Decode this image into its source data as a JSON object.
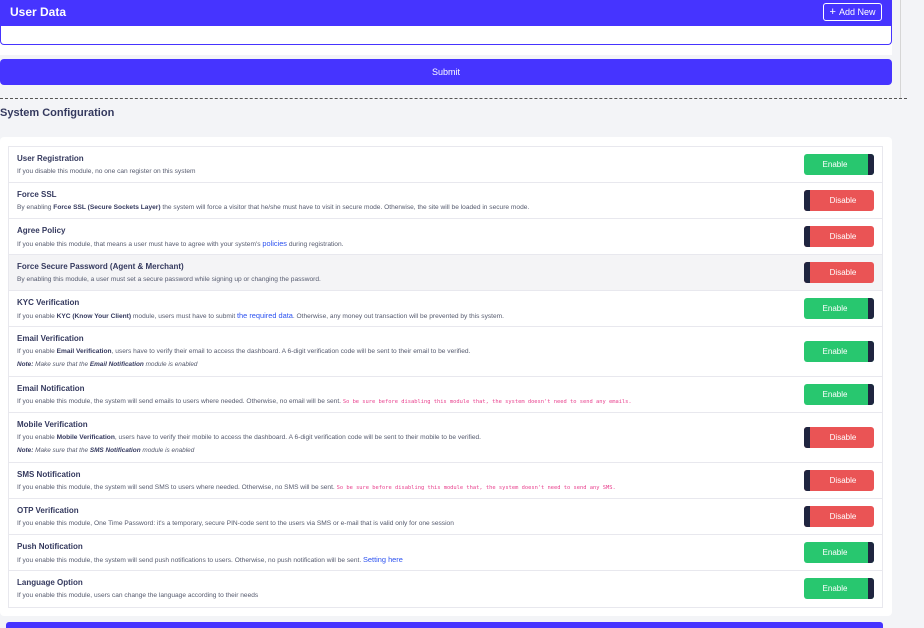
{
  "user_data": {
    "title": "User Data",
    "add_plus": "+",
    "add_label": "Add New",
    "submit_label": "Submit"
  },
  "section": {
    "title": "System Configuration"
  },
  "colors": {
    "primary": "#4634ff",
    "enable": "#28c76f",
    "disable": "#ea5455",
    "knob": "#1f2540"
  },
  "config": {
    "user_registration": {
      "title": "User Registration",
      "desc": "If you disable this module, no one can register on this system",
      "status": "Enable"
    },
    "force_ssl": {
      "title": "Force SSL",
      "desc_a": "By enabling ",
      "desc_b": "Force SSL (Secure Sockets Layer)",
      "desc_c": " the system will force a visitor that he/she must have to visit in secure mode. Otherwise, the site will be loaded in secure mode.",
      "status": "Disable"
    },
    "agree_policy": {
      "title": "Agree Policy",
      "desc_a": "If you enable this module, that means a user must have to agree with your system's ",
      "desc_link": "policies",
      "desc_c": " during registration.",
      "status": "Disable"
    },
    "force_secure_password": {
      "title": "Force Secure Password (Agent & Merchant)",
      "desc": "By enabling this module, a user must set a secure password while signing up or changing the password.",
      "status": "Disable"
    },
    "kyc": {
      "title": "KYC Verification",
      "desc_a": "If you enable ",
      "desc_b": "KYC (Know Your Client)",
      "desc_c": " module, users must have to submit ",
      "desc_link": "the required data",
      "desc_d": ". Otherwise, any money out transaction will be prevented by this system.",
      "status": "Enable"
    },
    "email_verification": {
      "title": "Email Verification",
      "desc_a": "If you enable ",
      "desc_b": "Email Verification",
      "desc_c": ", users have to verify their email to access the dashboard. A 6-digit verification code will be sent to their email to be verified.",
      "note_label": "Note:",
      "note_a": " Make sure that the ",
      "note_b": "Email Notification",
      "note_c": " module is enabled",
      "status": "Enable"
    },
    "email_notification": {
      "title": "Email Notification",
      "desc": "If you enable this module, the system will send emails to users where needed. Otherwise, no email will be sent. ",
      "code": "So be sure before disabling this module that, the system doesn't need to send any emails.",
      "status": "Enable"
    },
    "mobile_verification": {
      "title": "Mobile Verification",
      "desc_a": "If you enable ",
      "desc_b": "Mobile Verification",
      "desc_c": ", users have to verify their mobile to access the dashboard. A 6-digit verification code will be sent to their mobile to be verified.",
      "note_label": "Note:",
      "note_a": " Make sure that the ",
      "note_b": "SMS Notification",
      "note_c": " module is enabled",
      "status": "Disable"
    },
    "sms_notification": {
      "title": "SMS Notification",
      "desc": "If you enable this module, the system will send SMS to users where needed. Otherwise, no SMS will be sent. ",
      "code": "So be sure before disabling this module that, the system doesn't need to send any SMS.",
      "status": "Disable"
    },
    "otp_verification": {
      "title": "OTP Verification",
      "desc": "If you enable this module, One Time Password: it's a temporary, secure PIN-code sent to the users via SMS or e-mail that is valid only for one session",
      "status": "Disable"
    },
    "push_notification": {
      "title": "Push Notification",
      "desc": "If you enable this module, the system will send push notifications to users. Otherwise, no push notification will be sent. ",
      "desc_link": "Setting here",
      "status": "Enable"
    },
    "language_option": {
      "title": "Language Option",
      "desc": "If you enable this module, users can change the language according to their needs",
      "status": "Enable"
    }
  }
}
